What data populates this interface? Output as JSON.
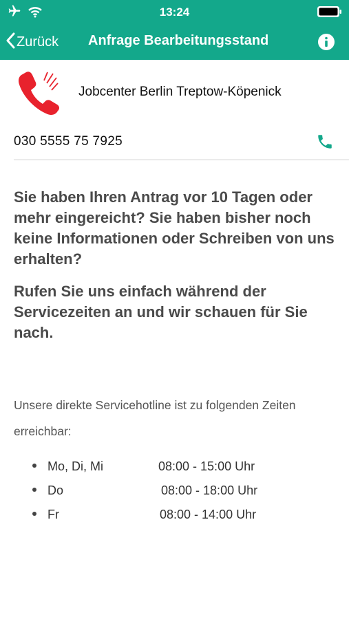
{
  "status_bar": {
    "time": "13:24"
  },
  "nav": {
    "back_label": "Zurück",
    "title": "Anfrage Bearbeitungsstand"
  },
  "contact": {
    "name": "Jobcenter Berlin Treptow-Köpenick",
    "phone": "030 5555 75 7925"
  },
  "content": {
    "paragraph1": "Sie haben Ihren Antrag vor 10 Tagen oder mehr eingereicht? Sie haben bisher noch keine Informationen oder Schreiben von uns erhalten?",
    "paragraph2": "Rufen Sie uns einfach während der Servicezeiten an und wir schauen für Sie nach.",
    "hours_intro": "Unsere direkte Servicehotline ist zu folgenden Zeiten erreichbar:",
    "hours": [
      {
        "days": "Mo, Di, Mi",
        "time": "08:00 - 15:00 Uhr"
      },
      {
        "days": "Do",
        "time": "08:00 - 18:00 Uhr"
      },
      {
        "days": "Fr",
        "time": "08:00 - 14:00 Uhr"
      }
    ]
  },
  "colors": {
    "header": "#13a88b",
    "phone_logo": "#e8222d",
    "call_icon": "#13a88b"
  },
  "icons": {
    "status": [
      "airplane-icon",
      "wifi-icon",
      "battery-icon"
    ],
    "nav_back": "chevron-left-icon",
    "nav_info": "info-icon",
    "contact_logo": "ringing-phone-icon",
    "call": "phone-icon"
  }
}
